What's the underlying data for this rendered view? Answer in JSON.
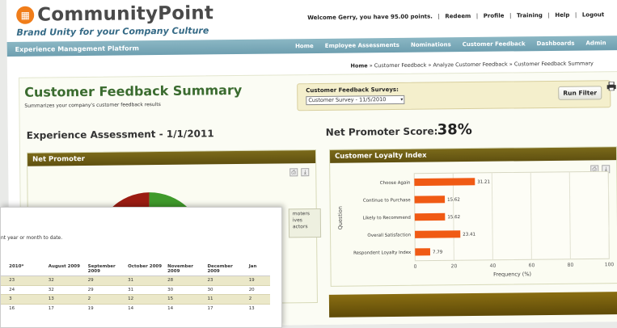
{
  "app": {
    "logo_text": "CommunityPoint",
    "tagline": "Brand Unity for your Company Culture"
  },
  "toplinks": {
    "welcome": "Welcome Gerry, you have 95.00 points.",
    "items": [
      "Redeem",
      "Profile",
      "Training",
      "Help",
      "Logout"
    ]
  },
  "navbar": {
    "brand": "Experience Management Platform",
    "items": [
      "Home",
      "Employee Assessments",
      "Nominations",
      "Customer Feedback",
      "Dashboards",
      "Admin"
    ]
  },
  "breadcrumb": {
    "home": "Home",
    "rest": " » Customer Feedback » Analyze Customer Feedback » Customer Feedback Summary"
  },
  "page": {
    "title": "Customer Feedback Summary",
    "subtitle": "Summarizes your company's customer feedback results"
  },
  "filter": {
    "label": "Customer Feedback Surveys:",
    "selected": "Customer Survey - 11/5/2010",
    "run_button": "Run Filter"
  },
  "assessment": {
    "title": "Experience Assessment - 1/1/2011",
    "nps_label": "Net Promoter Score:",
    "nps_value": "38%"
  },
  "panels": {
    "net_promoter": {
      "title": "Net Promoter",
      "legend": [
        "moters",
        "ives",
        "actors"
      ]
    },
    "loyalty": {
      "title": "Customer Loyalty Index"
    }
  },
  "pie_data": {
    "colors": {
      "detractors": "#9b1c12",
      "promoters": "#3f9a2b"
    }
  },
  "chart_data": {
    "type": "bar",
    "orientation": "horizontal",
    "categories": [
      "Choose Again",
      "Continue to Purchase",
      "Likely to Recommend",
      "Overall Satisfaction",
      "Respondent Loyalty Index"
    ],
    "values": [
      31.21,
      15.62,
      15.62,
      23.41,
      7.79
    ],
    "value_labels": [
      "31.21",
      "15.62",
      "15.62",
      "23.41",
      "7.79"
    ],
    "xlabel": "Frequency (%)",
    "ylabel": "Question",
    "xlim": [
      0,
      100
    ],
    "xticks": [
      "0",
      "20",
      "40",
      "60",
      "80",
      "100"
    ],
    "bar_color": "#f05a14",
    "grid": true
  },
  "overlay": {
    "desc": "nt year or month to date.",
    "headers": [
      "",
      "2010*",
      "August 2009",
      "September 2009",
      "October 2009",
      "November 2009",
      "December 2009",
      "Jan"
    ],
    "rows": [
      [
        "",
        "23",
        "32",
        "29",
        "31",
        "28",
        "23",
        "19"
      ],
      [
        "",
        "24",
        "32",
        "29",
        "31",
        "30",
        "30",
        "20"
      ],
      [
        "",
        "3",
        "13",
        "2",
        "12",
        "15",
        "11",
        "2"
      ],
      [
        "",
        "16",
        "17",
        "19",
        "14",
        "14",
        "17",
        "13"
      ]
    ]
  }
}
